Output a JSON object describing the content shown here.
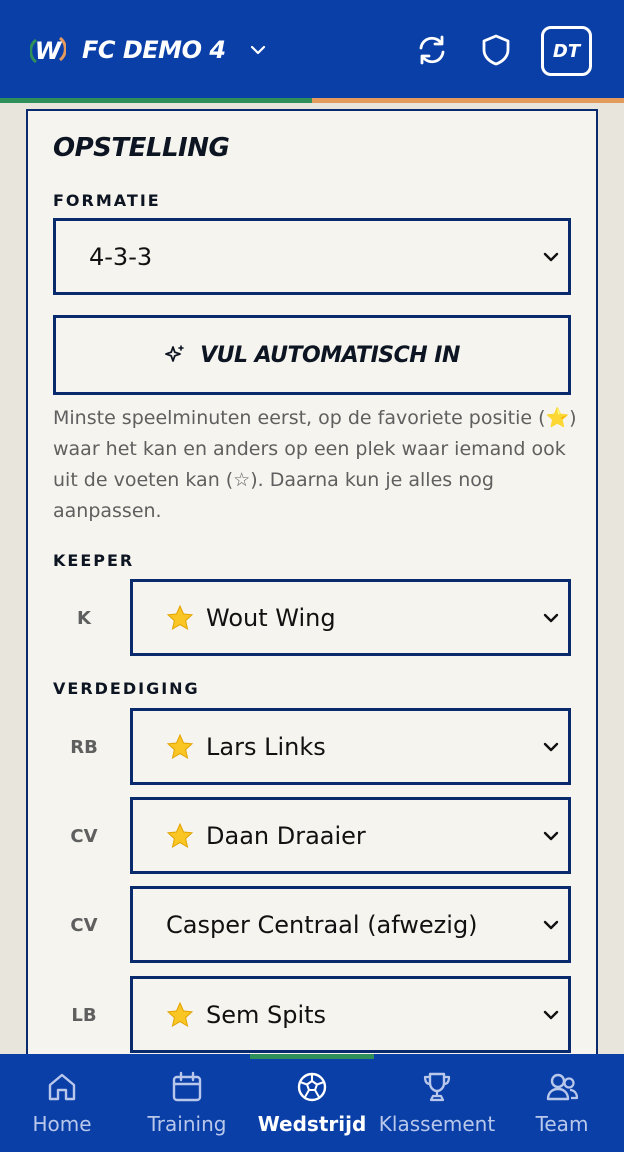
{
  "header": {
    "team_name": "FC DEMO 4",
    "avatar_initials": "DT",
    "stripe_colors": [
      "#2f8f5b",
      "#e39a5c"
    ]
  },
  "card": {
    "title": "OPSTELLING",
    "formation_label": "FORMATIE",
    "formation_value": "4-3-3",
    "auto_fill_label": "VUL AUTOMATISCH IN",
    "hint": "Minste speelminuten eerst, op de favoriete positie (⭐) waar het kan en anders op een plek waar iemand ook uit de voeten kan (☆). Daarna kun je alles nog aanpassen.",
    "keeper_label": "KEEPER",
    "defense_label": "VERDEDIGING",
    "positions": [
      {
        "pos": "K",
        "player": "Wout Wing",
        "star": true
      },
      {
        "pos": "RB",
        "player": "Lars Links",
        "star": true
      },
      {
        "pos": "CV",
        "player": "Daan Draaier",
        "star": true
      },
      {
        "pos": "CV",
        "player": "Casper Centraal (afwezig)",
        "star": false
      },
      {
        "pos": "LB",
        "player": "Sem Spits",
        "star": true
      }
    ]
  },
  "nav": {
    "items": [
      {
        "label": "Home",
        "icon": "home-icon"
      },
      {
        "label": "Training",
        "icon": "calendar-icon"
      },
      {
        "label": "Wedstrijd",
        "icon": "soccer-ball-icon",
        "active": true
      },
      {
        "label": "Klassement",
        "icon": "trophy-icon"
      },
      {
        "label": "Team",
        "icon": "team-icon"
      }
    ]
  },
  "colors": {
    "brand_blue": "#0a3fa8",
    "border_navy": "#0a2a6e",
    "accent_green": "#2f8f5b",
    "accent_orange": "#e39a5c"
  }
}
